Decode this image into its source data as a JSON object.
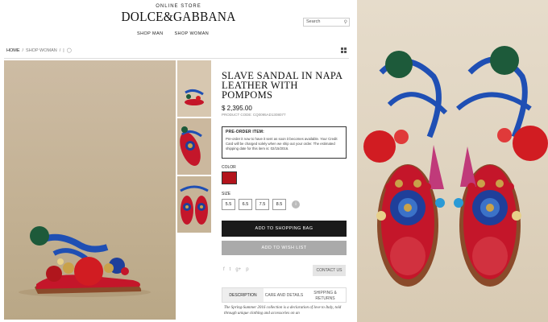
{
  "header": {
    "store_subtitle": "ONLINE STORE",
    "logo": "DOLCE&GABBANA",
    "nav": [
      "SHOP MAN",
      "SHOP WOMAN"
    ],
    "search_placeholder": "Search"
  },
  "breadcrumb": {
    "home": "HOME",
    "section": "SHOP WOMAN",
    "separator": "/",
    "trailing": "|"
  },
  "product": {
    "title": "SLAVE SANDAL IN NAPA LEATHER WITH POMPOMS",
    "price": "$ 2,395.00",
    "code": "PRODUCT CODE: CQ0095AD1308077",
    "preorder_title": "PRE-ORDER ITEM:",
    "preorder_text": "Pre-order it now to have it sent as soon it becomes available. Your Credit Card will be charged solely when we ship out your order. The estimated shipping date for this item is: 02/15/2016.",
    "color_label": "COLOR",
    "color_value": "#b3141c",
    "size_label": "SIZE",
    "sizes": [
      "5.5",
      "6.5",
      "7.5",
      "8.5"
    ],
    "add_to_bag": "ADD TO SHOPPING BAG",
    "add_to_wishlist": "ADD TO WISH LIST",
    "contact": "CONTACT US",
    "social": [
      "f",
      "t",
      "g+",
      "p"
    ]
  },
  "tabs": [
    {
      "label": "DESCRIPTION",
      "active": true
    },
    {
      "label": "CARE AND DETAILS",
      "active": false
    },
    {
      "label": "SHIPPING & RETURNS",
      "active": false
    }
  ],
  "description": "The Spring-Summer 2016 collection is a declaration of love to Italy, told through unique clothing and accessories on an",
  "colors": {
    "sandal_red": "#c4162a",
    "strap_blue": "#1f4fb4",
    "pompom_green": "#1d5a3a",
    "tassel_pink": "#c03a7a",
    "gold": "#c9a24a"
  }
}
